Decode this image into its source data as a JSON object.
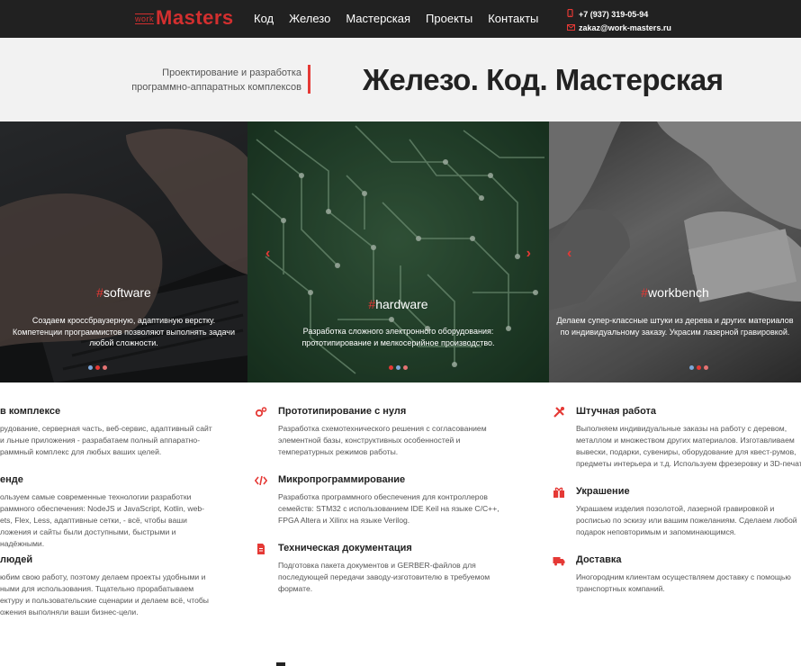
{
  "logo": {
    "small": "work",
    "main": "Masters"
  },
  "nav": [
    "Код",
    "Железо",
    "Мастерская",
    "Проекты",
    "Контакты"
  ],
  "contacts": {
    "phone": "+7 (937) 319-05-94",
    "email": "zakaz@work-masters.ru"
  },
  "hero": {
    "tagline_line1": "Проектирование и разработка",
    "tagline_line2": "программно-аппаратных комплексов",
    "headline": "Железо. Код. Мастерская"
  },
  "panels": [
    {
      "tag": "software",
      "desc": "Создаем кроссбраузерную, адаптивную верстку. Компетенции программистов позволяют выполнять задачи любой сложности."
    },
    {
      "tag": "hardware",
      "desc": "Разработка сложного электронного оборудования: прототипирование и мелкосерийное производство."
    },
    {
      "tag": "workbench",
      "desc": "Делаем супер-классные штуки из дерева и других материалов по индивидуальному заказу. Украсим лазерной гравировкой."
    }
  ],
  "services": {
    "col1": [
      {
        "title": "в комплексе",
        "text": "рудование, серверная часть, веб-сервис, адаптивный сайт и льные приложения - разрабатаем полный аппаратно-раммный комплекс для любых ваших целей."
      },
      {
        "title": "енде",
        "text": "ользуем самые современные технологии разработки раммного обеспечения: NodeJS и JavaScript, Kotlin, web-ets, Flex, Less, адаптивные сетки, - всё, чтобы ваши ложения и сайты были доступными, быстрыми и надёжными."
      },
      {
        "title": "людей",
        "text": "юбим свою работу, поэтому делаем проекты удобными и ными для использования. Тщательно прорабатываем ектуру и пользовательские сценарии и делаем всё, чтобы ожения выполняли ваши бизнес-цели."
      }
    ],
    "col2": [
      {
        "icon": "gears-icon",
        "title": "Прототипирование с нуля",
        "text": "Разработка схемотехнического решения с согласованием элементной базы, конструктивных особенностей и температурных режимов работы."
      },
      {
        "icon": "code-icon",
        "title": "Микропрограммирование",
        "text": "Разработка программного обеспечения для контроллеров семейств: STM32 с использованием IDE Keil на языке C/C++, FPGA Altera и Xilinx на языке Verilog."
      },
      {
        "icon": "document-icon",
        "title": "Техническая документация",
        "text": "Подготовка пакета документов и GERBER-файлов для последующей передачи заводу-изготовителю в требуемом формате."
      }
    ],
    "col3": [
      {
        "icon": "tools-icon",
        "title": "Штучная работа",
        "text": "Выполняем индивидуальные заказы на работу с деревом, металлом и множеством других материалов. Изготавливаем вывески, подарки, сувениры, оборудование для квест-румов, предметы интерьера и т.д. Используем фрезеровку и 3D-печать."
      },
      {
        "icon": "gift-icon",
        "title": "Украшение",
        "text": "Украшаем изделия позолотой, лазерной гравировкой и росписью по эскизу или вашим пожеланиям. Сделаем любой подарок неповторимым и запоминающимся."
      },
      {
        "icon": "truck-icon",
        "title": "Доставка",
        "text": "Иногородним клиентам осуществляем доставку с помощью транспортных компаний."
      }
    ]
  },
  "colors": {
    "accent": "#e53935",
    "topbar": "#212121",
    "hero_bg": "#f2f2f2"
  }
}
